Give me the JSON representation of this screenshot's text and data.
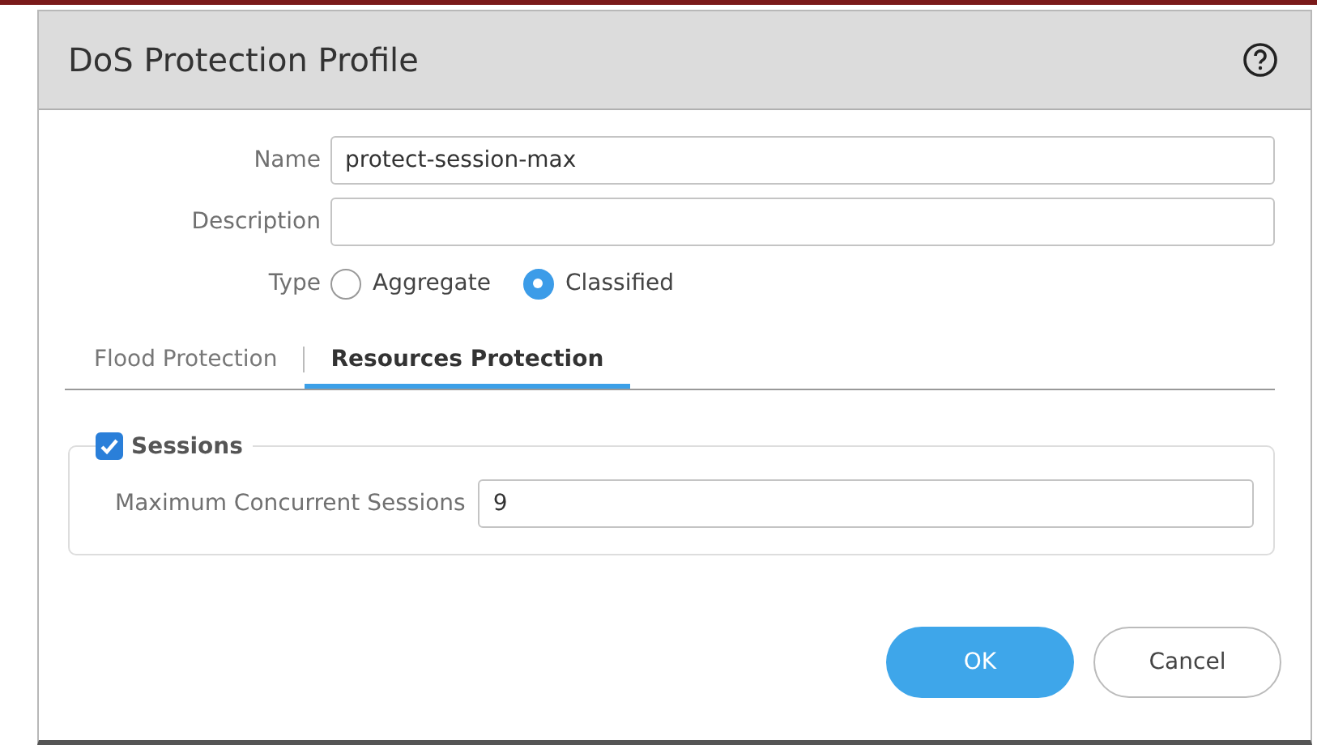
{
  "dialog": {
    "title": "DoS Protection Profile"
  },
  "name": {
    "label": "Name",
    "value": "protect-session-max"
  },
  "description": {
    "label": "Description"
  },
  "type": {
    "label": "Type",
    "options": [
      {
        "label": "Aggregate",
        "selected": false
      },
      {
        "label": "Classified",
        "selected": true
      }
    ]
  },
  "tabs": [
    {
      "label": "Flood Protection",
      "selected": false
    },
    {
      "label": "Resources Protection",
      "selected": true
    }
  ],
  "sessions": {
    "label": "Sessions",
    "checked": true,
    "field": {
      "label": "Maximum Concurrent Sessions",
      "value": "9"
    }
  },
  "buttons": [
    {
      "label": "OK",
      "kind": "primary"
    },
    {
      "label": "Cancel",
      "kind": "secondary"
    }
  ]
}
